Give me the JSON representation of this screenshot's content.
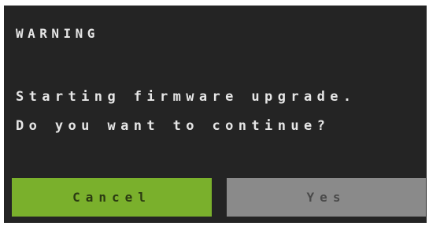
{
  "dialog": {
    "title": "WARNING",
    "message_lines": [
      "Starting firmware upgrade.",
      "Do you want to continue?"
    ],
    "buttons": {
      "cancel_label": "Cancel",
      "yes_label": "Yes"
    }
  },
  "colors": {
    "background": "#242424",
    "text": "#e6e6e6",
    "cancel_button": "#7ab02c",
    "yes_button": "#8a8a8a"
  }
}
